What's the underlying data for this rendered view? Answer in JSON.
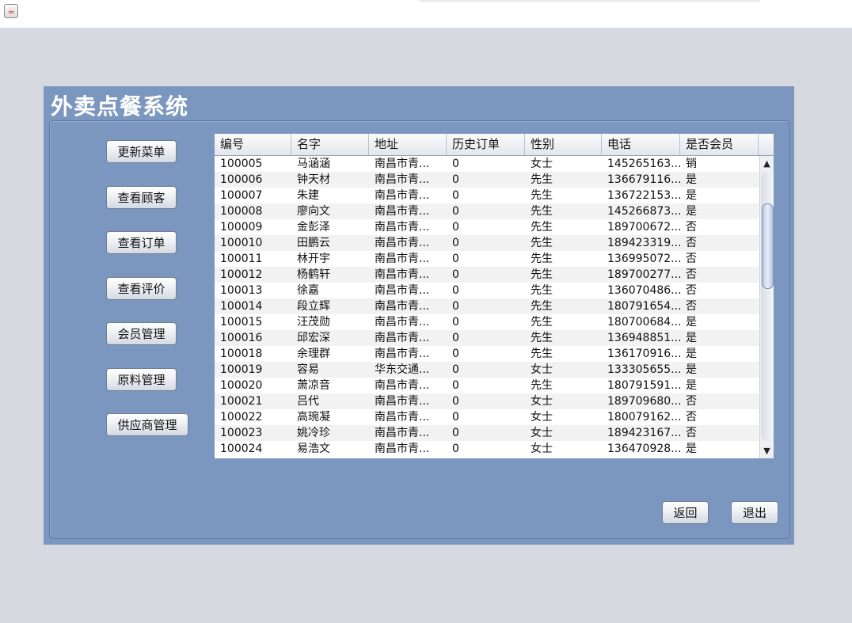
{
  "window": {
    "icon": "java-icon"
  },
  "app": {
    "title": "外卖点餐系统"
  },
  "nav": [
    {
      "label": "更新菜单"
    },
    {
      "label": "查看顾客"
    },
    {
      "label": "查看订单"
    },
    {
      "label": "查看评价"
    },
    {
      "label": "会员管理"
    },
    {
      "label": "原料管理"
    },
    {
      "label": "供应商管理"
    }
  ],
  "table": {
    "columns": [
      "编号",
      "名字",
      "地址",
      "历史订单",
      "性别",
      "电话",
      "是否会员"
    ],
    "rows": [
      [
        "100005",
        "马涵涵",
        "南昌市青...",
        "0",
        "女士",
        "145265163...",
        "销"
      ],
      [
        "100006",
        "钟天材",
        "南昌市青...",
        "0",
        "先生",
        "136679116...",
        "是"
      ],
      [
        "100007",
        "朱建",
        "南昌市青...",
        "0",
        "先生",
        "136722153...",
        "是"
      ],
      [
        "100008",
        "廖向文",
        "南昌市青...",
        "0",
        "先生",
        "145266873...",
        "是"
      ],
      [
        "100009",
        "金彭泽",
        "南昌市青...",
        "0",
        "先生",
        "189700672...",
        "否"
      ],
      [
        "100010",
        "田鹏云",
        "南昌市青...",
        "0",
        "先生",
        "189423319...",
        "否"
      ],
      [
        "100011",
        "林开宇",
        "南昌市青...",
        "0",
        "先生",
        "136995072...",
        "否"
      ],
      [
        "100012",
        "杨鹤轩",
        "南昌市青...",
        "0",
        "先生",
        "189700277...",
        "否"
      ],
      [
        "100013",
        "徐嘉",
        "南昌市青...",
        "0",
        "先生",
        "136070486...",
        "否"
      ],
      [
        "100014",
        "段立辉",
        "南昌市青...",
        "0",
        "先生",
        "180791654...",
        "否"
      ],
      [
        "100015",
        "汪茂勋",
        "南昌市青...",
        "0",
        "先生",
        "180700684...",
        "是"
      ],
      [
        "100016",
        "邱宏深",
        "南昌市青...",
        "0",
        "先生",
        "136948851...",
        "是"
      ],
      [
        "100018",
        "余理群",
        "南昌市青...",
        "0",
        "先生",
        "136170916...",
        "是"
      ],
      [
        "100019",
        "容易",
        "华东交通...",
        "0",
        "女士",
        "133305655...",
        "是"
      ],
      [
        "100020",
        "萧凉音",
        "南昌市青...",
        "0",
        "先生",
        "180791591...",
        "是"
      ],
      [
        "100021",
        "吕代",
        "南昌市青...",
        "0",
        "女士",
        "189709680...",
        "否"
      ],
      [
        "100022",
        "高琬凝",
        "南昌市青...",
        "0",
        "女士",
        "180079162...",
        "否"
      ],
      [
        "100023",
        "姚冷珍",
        "南昌市青...",
        "0",
        "女士",
        "189423167...",
        "否"
      ],
      [
        "100024",
        "易浩文",
        "南昌市青...",
        "0",
        "女士",
        "136470928...",
        "是"
      ]
    ]
  },
  "scrollbar": {
    "up_glyph": "▲",
    "down_glyph": "▼"
  },
  "footer": {
    "back_label": "返回",
    "exit_label": "退出"
  }
}
